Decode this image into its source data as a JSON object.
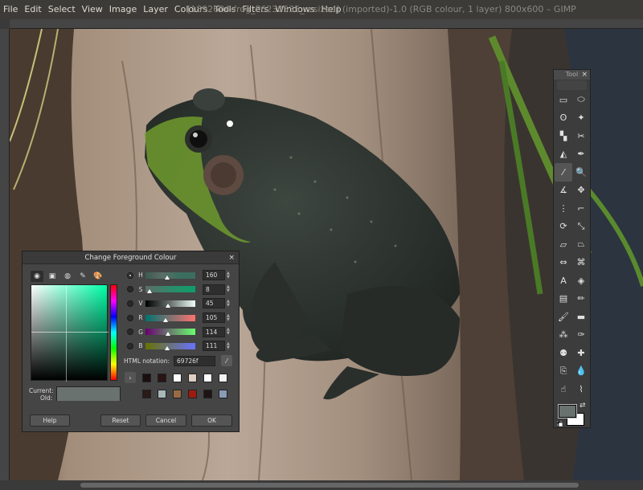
{
  "window": {
    "title": "[1892604-frog_P6230535_resized] (imported)-1.0 (RGB colour, 1 layer) 800x600 – GIMP"
  },
  "menu": [
    "File",
    "Edit",
    "Select",
    "View",
    "Image",
    "Layer",
    "Colours",
    "Tools",
    "Filters",
    "Windows",
    "Help"
  ],
  "toolbox": {
    "title": "Tool",
    "close": "×",
    "tools": [
      {
        "name": "rect-select-icon",
        "glyph": "▭"
      },
      {
        "name": "ellipse-select-icon",
        "glyph": "⬭"
      },
      {
        "name": "free-select-icon",
        "glyph": "ʘ"
      },
      {
        "name": "fuzzy-select-icon",
        "glyph": "✦"
      },
      {
        "name": "select-by-color-icon",
        "glyph": "▚"
      },
      {
        "name": "scissors-select-icon",
        "glyph": "✂"
      },
      {
        "name": "foreground-select-icon",
        "glyph": "◭"
      },
      {
        "name": "paths-icon",
        "glyph": "✒"
      },
      {
        "name": "color-picker-icon",
        "glyph": "⁄"
      },
      {
        "name": "zoom-icon",
        "glyph": "🔍"
      },
      {
        "name": "measure-icon",
        "glyph": "∡"
      },
      {
        "name": "move-icon",
        "glyph": "✥"
      },
      {
        "name": "alignment-icon",
        "glyph": "⋮"
      },
      {
        "name": "crop-icon",
        "glyph": "⌐"
      },
      {
        "name": "rotate-icon",
        "glyph": "⟳"
      },
      {
        "name": "scale-icon",
        "glyph": "⤡"
      },
      {
        "name": "shear-icon",
        "glyph": "▱"
      },
      {
        "name": "perspective-icon",
        "glyph": "⏢"
      },
      {
        "name": "flip-icon",
        "glyph": "⇔"
      },
      {
        "name": "cage-transform-icon",
        "glyph": "⌘"
      },
      {
        "name": "text-icon",
        "glyph": "A"
      },
      {
        "name": "bucket-fill-icon",
        "glyph": "◈"
      },
      {
        "name": "blend-icon",
        "glyph": "▤"
      },
      {
        "name": "pencil-icon",
        "glyph": "✏"
      },
      {
        "name": "paintbrush-icon",
        "glyph": "🖌"
      },
      {
        "name": "eraser-icon",
        "glyph": "▬"
      },
      {
        "name": "airbrush-icon",
        "glyph": "⁂"
      },
      {
        "name": "ink-icon",
        "glyph": "✑"
      },
      {
        "name": "clone-icon",
        "glyph": "⚉"
      },
      {
        "name": "heal-icon",
        "glyph": "✚"
      },
      {
        "name": "perspective-clone-icon",
        "glyph": "⎘"
      },
      {
        "name": "blur-sharpen-icon",
        "glyph": "💧"
      },
      {
        "name": "smudge-icon",
        "glyph": "☝"
      },
      {
        "name": "dodge-burn-icon",
        "glyph": "⌇"
      }
    ],
    "fg_color": "#69726f",
    "bg_color": "#ffffff"
  },
  "dialog": {
    "title": "Change Foreground Colour",
    "close": "×",
    "tabs": [
      {
        "name": "gimp-selector-tab-icon",
        "glyph": "◉"
      },
      {
        "name": "cmyk-selector-tab-icon",
        "glyph": "▣"
      },
      {
        "name": "wheel-selector-tab-icon",
        "glyph": "◍"
      },
      {
        "name": "watercolor-selector-tab-icon",
        "glyph": "✎"
      },
      {
        "name": "palette-selector-tab-icon",
        "glyph": "🎨"
      }
    ],
    "scales": [
      {
        "label": "H",
        "value": "160",
        "fraction": 0.44,
        "gradient": "linear-gradient(to right,#3d5a51,#5b6e68,#3b6e5e,#3b6e60)"
      },
      {
        "label": "S",
        "value": "8",
        "fraction": 0.08,
        "gradient": "linear-gradient(to right,#5f6b66,#2e8a6a,#0d9e6a)"
      },
      {
        "label": "V",
        "value": "45",
        "fraction": 0.45,
        "gradient": "linear-gradient(to right,#000,#69726f,#f0fffa)"
      },
      {
        "label": "R",
        "value": "105",
        "fraction": 0.41,
        "gradient": "linear-gradient(to right,#00726f,#ff726f)"
      },
      {
        "label": "G",
        "value": "114",
        "fraction": 0.45,
        "gradient": "linear-gradient(to right,#69006f,#69ff6f)"
      },
      {
        "label": "B",
        "value": "111",
        "fraction": 0.44,
        "gradient": "linear-gradient(to right,#697200,#6972ff)"
      }
    ],
    "html_label": "HTML notation:",
    "html_value": "69726f",
    "history_colors": [
      "#1a0f0f",
      "#2a1414",
      "#ffffff",
      "#e0cec2",
      "#ffffff",
      "#f2f2f2",
      "#2a1a18",
      "#a8b8b6",
      "#9a6a44",
      "#9e1a10",
      "#1e1414",
      "#8a9ab8"
    ],
    "current_label": "Current:",
    "old_label": "Old:",
    "current_color": "#69726f",
    "old_color": "#69726f",
    "buttons": {
      "help": "Help",
      "reset": "Reset",
      "cancel": "Cancel",
      "ok": "OK"
    }
  }
}
